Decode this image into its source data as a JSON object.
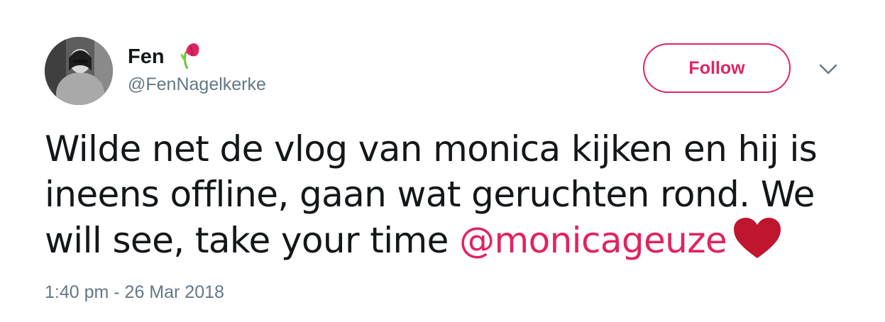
{
  "author": {
    "display_name": "Fen",
    "handle": "@FenNagelkerke",
    "avatar_icon": "user-avatar",
    "name_emoji_icon": "wilted-flower-icon"
  },
  "actions": {
    "follow_label": "Follow",
    "menu_icon": "chevron-down-icon"
  },
  "tweet": {
    "text_line1": "Wilde net de vlog van monica kijken en hij is",
    "text_line2": "ineens offline, gaan wat geruchten rond. We",
    "text_line3_prefix": "will see, take your time ",
    "mention": "@monicageuze",
    "trailing_emoji_icon": "red-heart-icon",
    "timestamp": "1:40 pm - 26 Mar 2018"
  },
  "colors": {
    "accent": "#e0245e",
    "text": "#14171a",
    "muted": "#657786",
    "heart": "#c0152f"
  }
}
